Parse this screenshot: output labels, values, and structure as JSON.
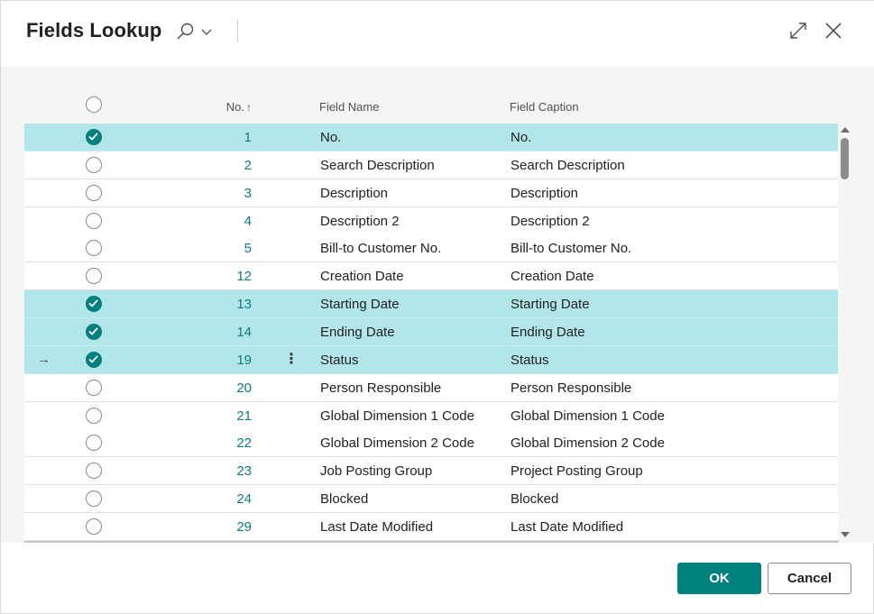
{
  "dialog": {
    "title": "Fields Lookup",
    "accent_color": "#00807f",
    "selected_row_color": "#b3e6ea",
    "link_color": "#0f7a85"
  },
  "header": {
    "search_icon": "search-icon",
    "dropdown_icon": "chevron-down-icon",
    "expand_icon": "expand-icon",
    "close_icon": "close-icon"
  },
  "columns": {
    "no": "No.",
    "no_sort_glyph": "↑",
    "field_name": "Field Name",
    "field_caption": "Field Caption"
  },
  "rows": [
    {
      "no": "1",
      "field_name": "No.",
      "field_caption": "No.",
      "checked": true
    },
    {
      "no": "2",
      "field_name": "Search Description",
      "field_caption": "Search Description",
      "checked": false
    },
    {
      "no": "3",
      "field_name": "Description",
      "field_caption": "Description",
      "checked": false
    },
    {
      "no": "4",
      "field_name": "Description 2",
      "field_caption": "Description 2",
      "checked": false
    },
    {
      "no": "5",
      "field_name": "Bill-to Customer No.",
      "field_caption": "Bill-to Customer No.",
      "checked": false
    },
    {
      "no": "12",
      "field_name": "Creation Date",
      "field_caption": "Creation Date",
      "checked": false
    },
    {
      "no": "13",
      "field_name": "Starting Date",
      "field_caption": "Starting Date",
      "checked": true
    },
    {
      "no": "14",
      "field_name": "Ending Date",
      "field_caption": "Ending Date",
      "checked": true
    },
    {
      "no": "19",
      "field_name": "Status",
      "field_caption": "Status",
      "checked": true,
      "current": true,
      "arrow": "→",
      "menu_glyph": "⋮"
    },
    {
      "no": "20",
      "field_name": "Person Responsible",
      "field_caption": "Person Responsible",
      "checked": false
    },
    {
      "no": "21",
      "field_name": "Global Dimension 1 Code",
      "field_caption": "Global Dimension 1 Code",
      "checked": false
    },
    {
      "no": "22",
      "field_name": "Global Dimension 2 Code",
      "field_caption": "Global Dimension 2 Code",
      "checked": false
    },
    {
      "no": "23",
      "field_name": "Job Posting Group",
      "field_caption": "Project Posting Group",
      "checked": false
    },
    {
      "no": "24",
      "field_name": "Blocked",
      "field_caption": "Blocked",
      "checked": false
    },
    {
      "no": "29",
      "field_name": "Last Date Modified",
      "field_caption": "Last Date Modified",
      "checked": false
    }
  ],
  "footer": {
    "ok_label": "OK",
    "cancel_label": "Cancel"
  }
}
